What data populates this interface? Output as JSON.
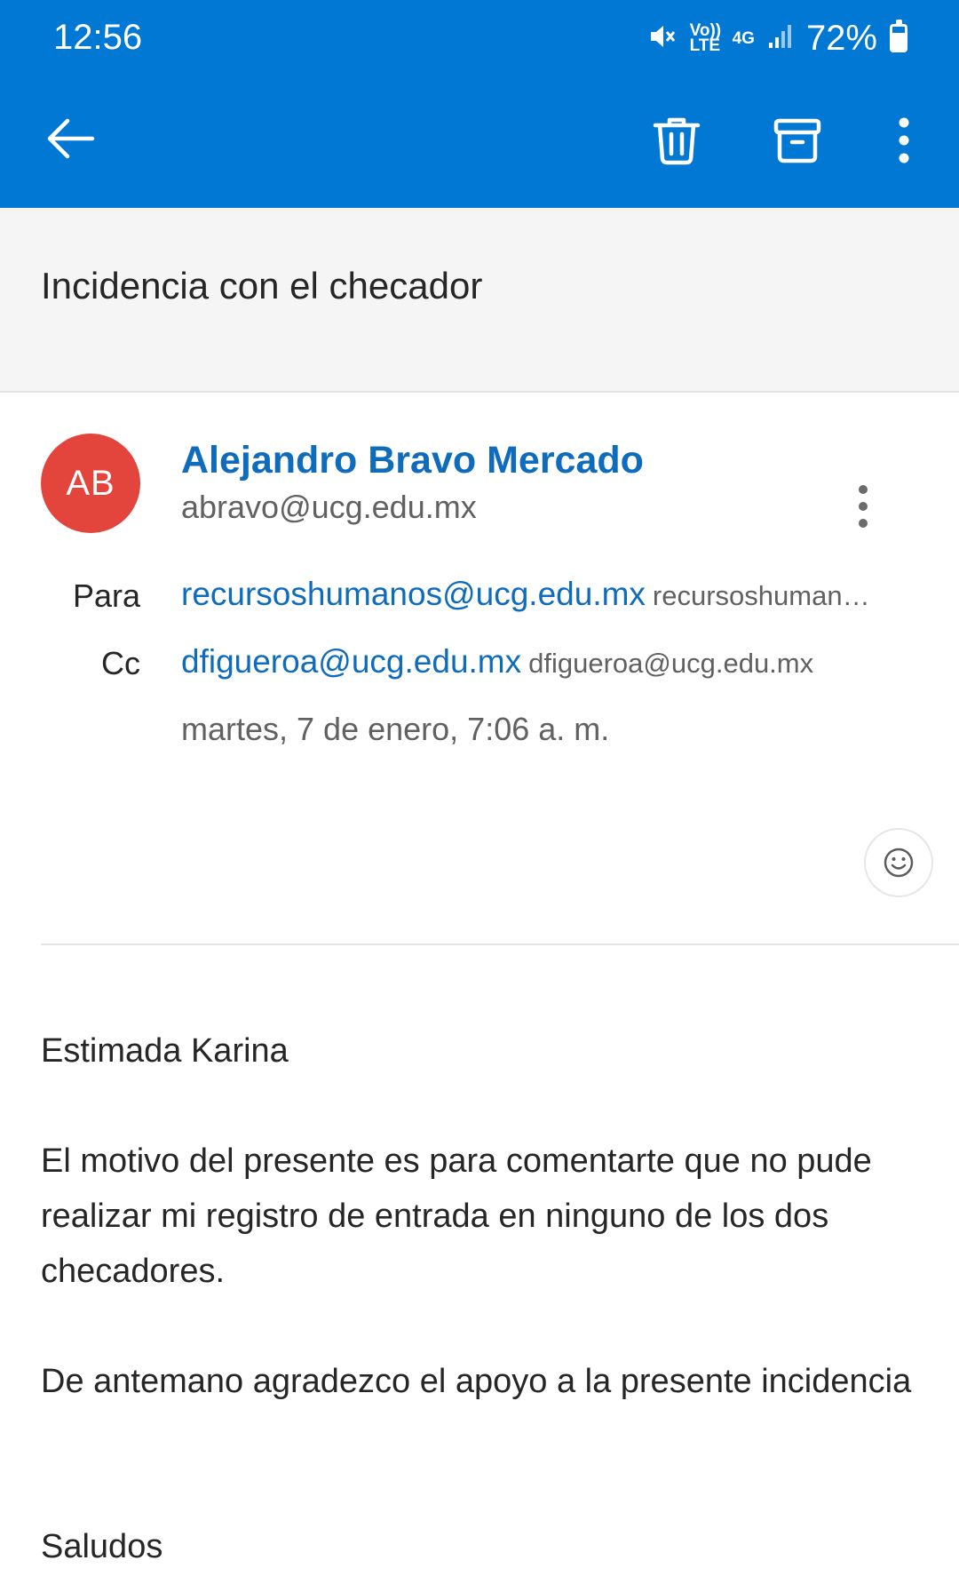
{
  "status_bar": {
    "time": "12:56",
    "volte_label": "Vo)) LTE",
    "network_label": "4G",
    "battery_percent": "72%",
    "battery_level": 0.72,
    "icons": [
      "mute-icon",
      "volte-icon",
      "4g-icon",
      "signal-icon",
      "battery-icon"
    ]
  },
  "toolbar": {
    "icons": [
      "back-arrow-icon",
      "trash-icon",
      "archive-icon",
      "more-vertical-icon"
    ]
  },
  "subject": "Incidencia con el checador",
  "sender": {
    "initials": "AB",
    "avatar_color": "#e3443b",
    "name": "Alejandro Bravo Mercado",
    "email": "abravo@ucg.edu.mx"
  },
  "recipients": {
    "to_label": "Para",
    "to_email": "recursoshumanos@ucg.edu.mx",
    "to_name": "recursoshuman…",
    "cc_label": "Cc",
    "cc_email": "dfigueroa@ucg.edu.mx",
    "cc_name": "dfigueroa@ucg.edu.mx"
  },
  "date": "martes, 7 de enero, 7:06 a. m.",
  "body": {
    "greeting": "Estimada Karina",
    "paragraph1": "El motivo del presente es para comentarte que no pude realizar mi registro de entrada en ninguno de los dos checadores.",
    "paragraph2": "De antemano agradezco el apoyo a la presente incidencia",
    "closing": "Saludos"
  },
  "colors": {
    "brand": "#0078d4",
    "link": "#0f6cbd",
    "subject_bg": "#f5f5f5"
  }
}
